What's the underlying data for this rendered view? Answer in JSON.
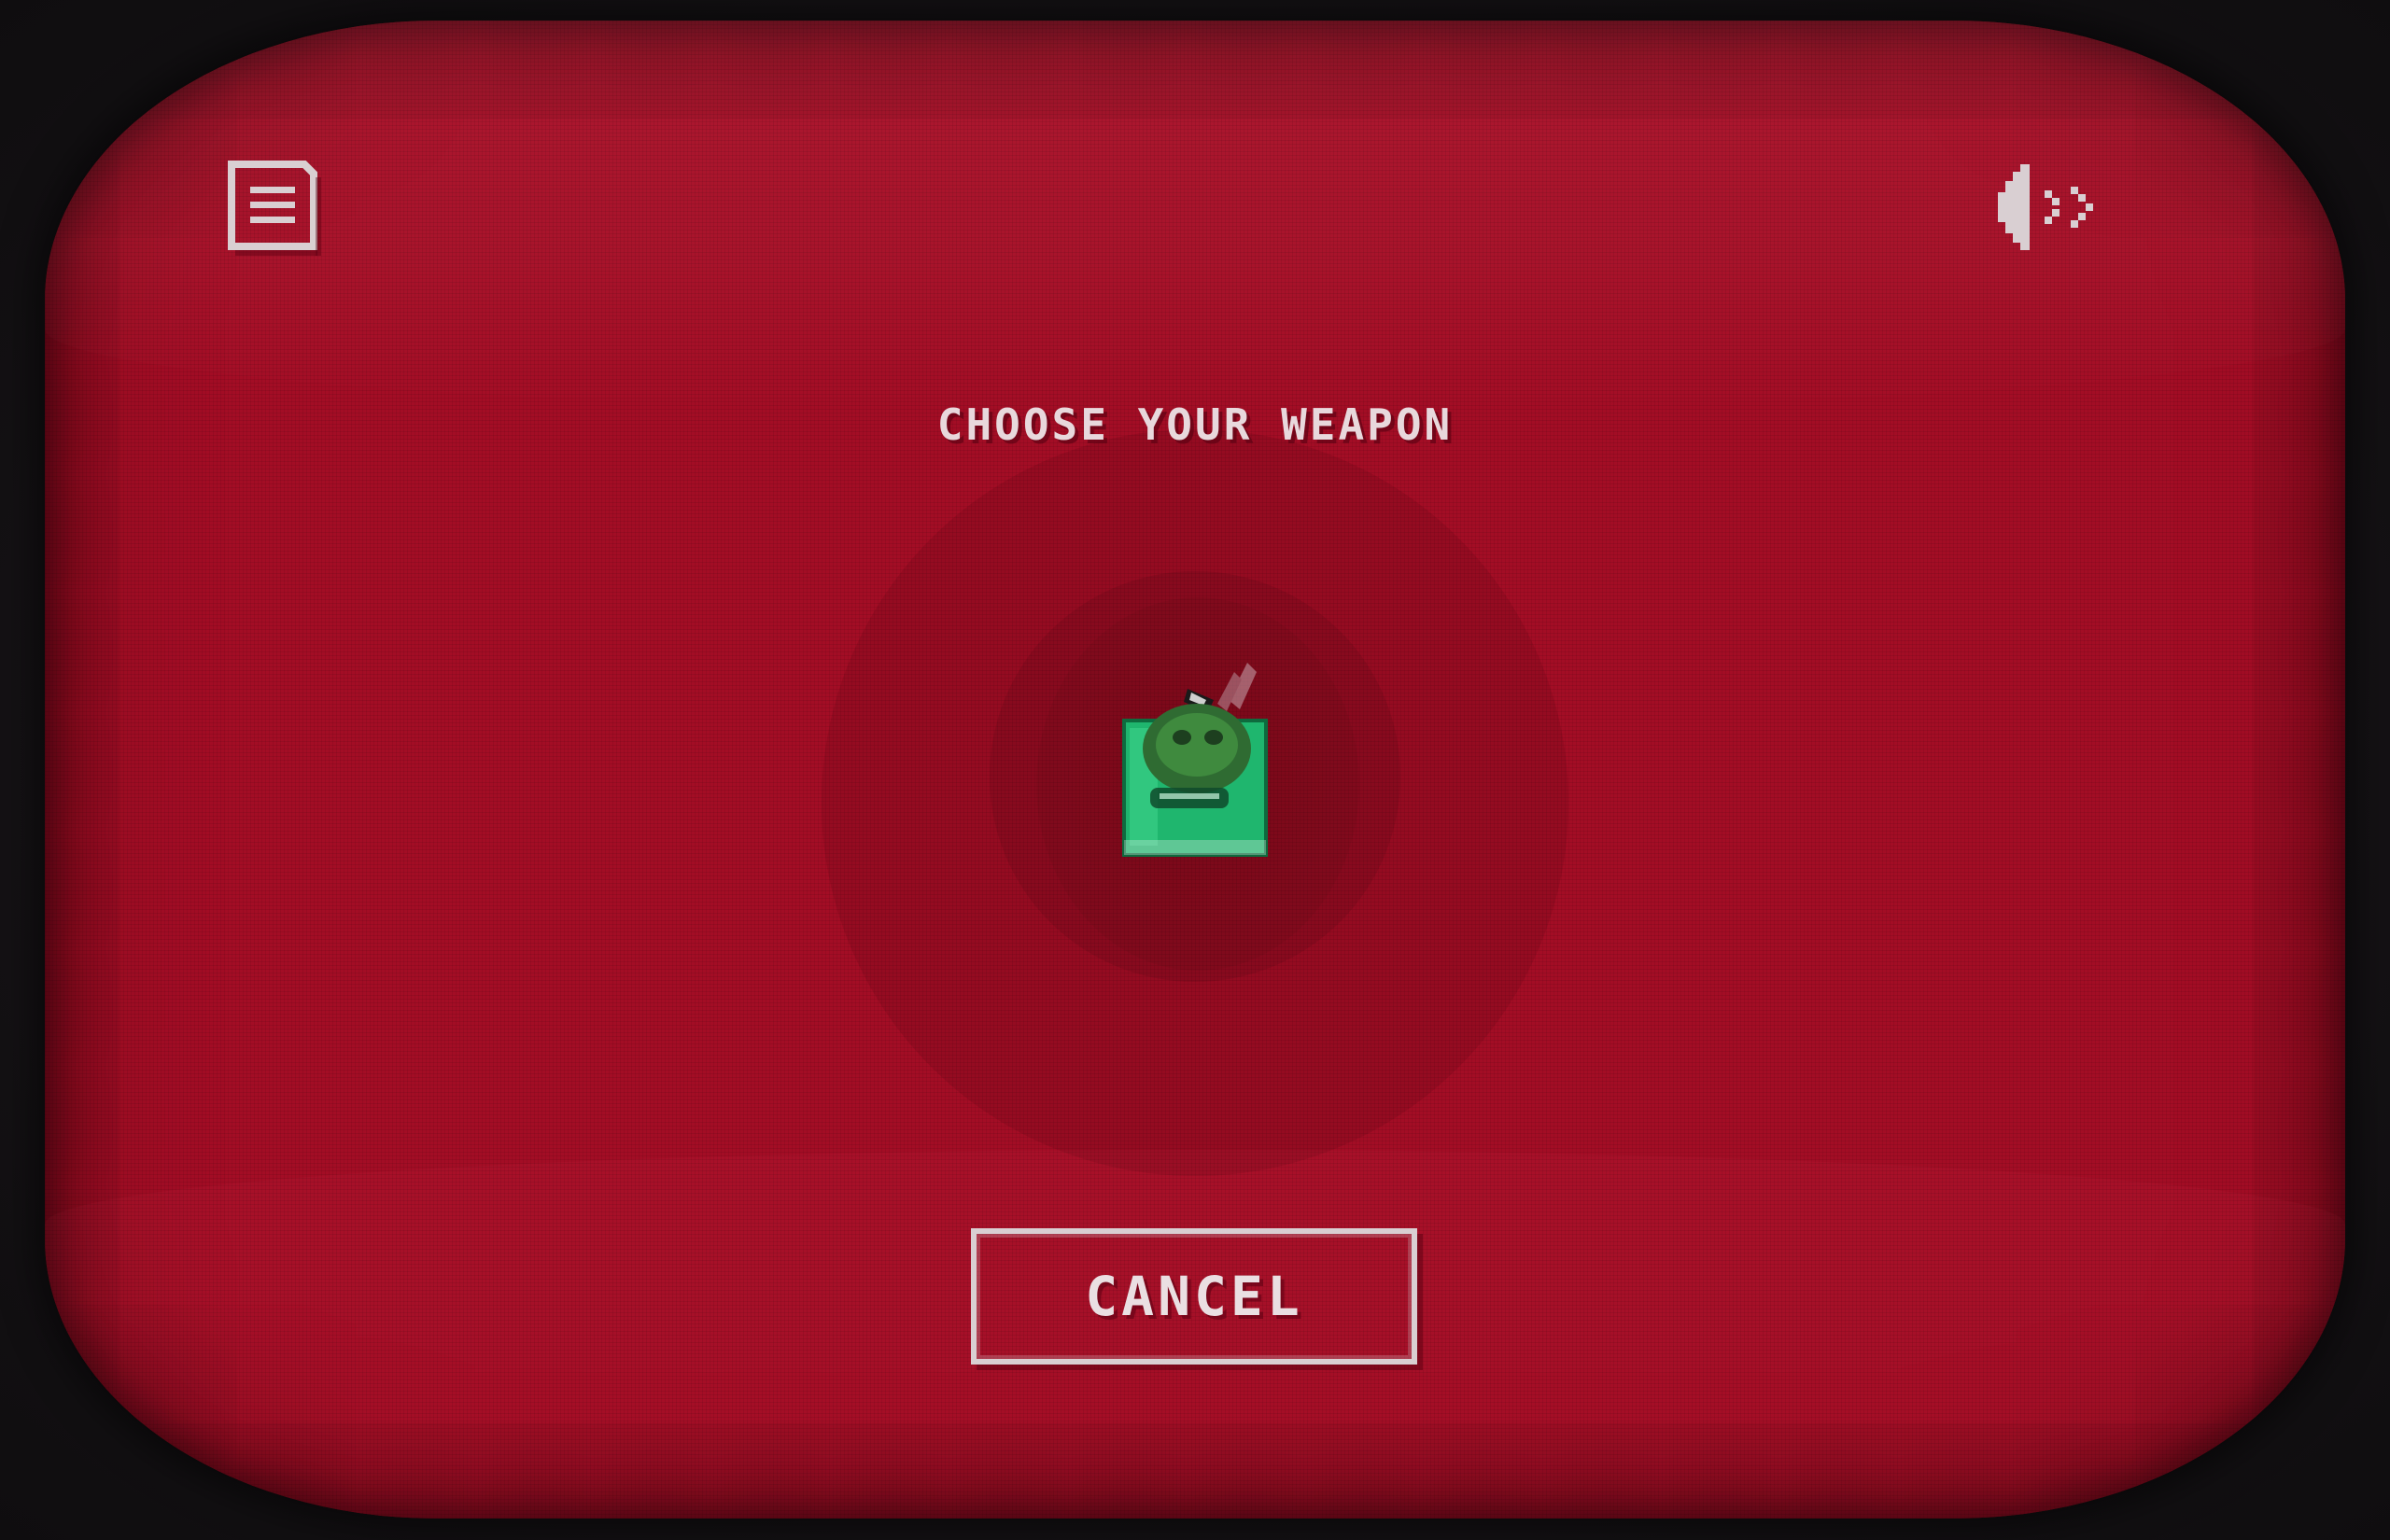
{
  "screen": {
    "title": "CHOOSE YOUR WEAPON",
    "accent_color": "#a30d25",
    "text_color": "#e8d8dc"
  },
  "toolbar": {
    "menu_icon": "menu-list-icon",
    "sound_icon": "sound-on-icon"
  },
  "weapon": {
    "icon": "green-potion-jar-icon"
  },
  "actions": {
    "cancel_label": "CANCEL"
  }
}
